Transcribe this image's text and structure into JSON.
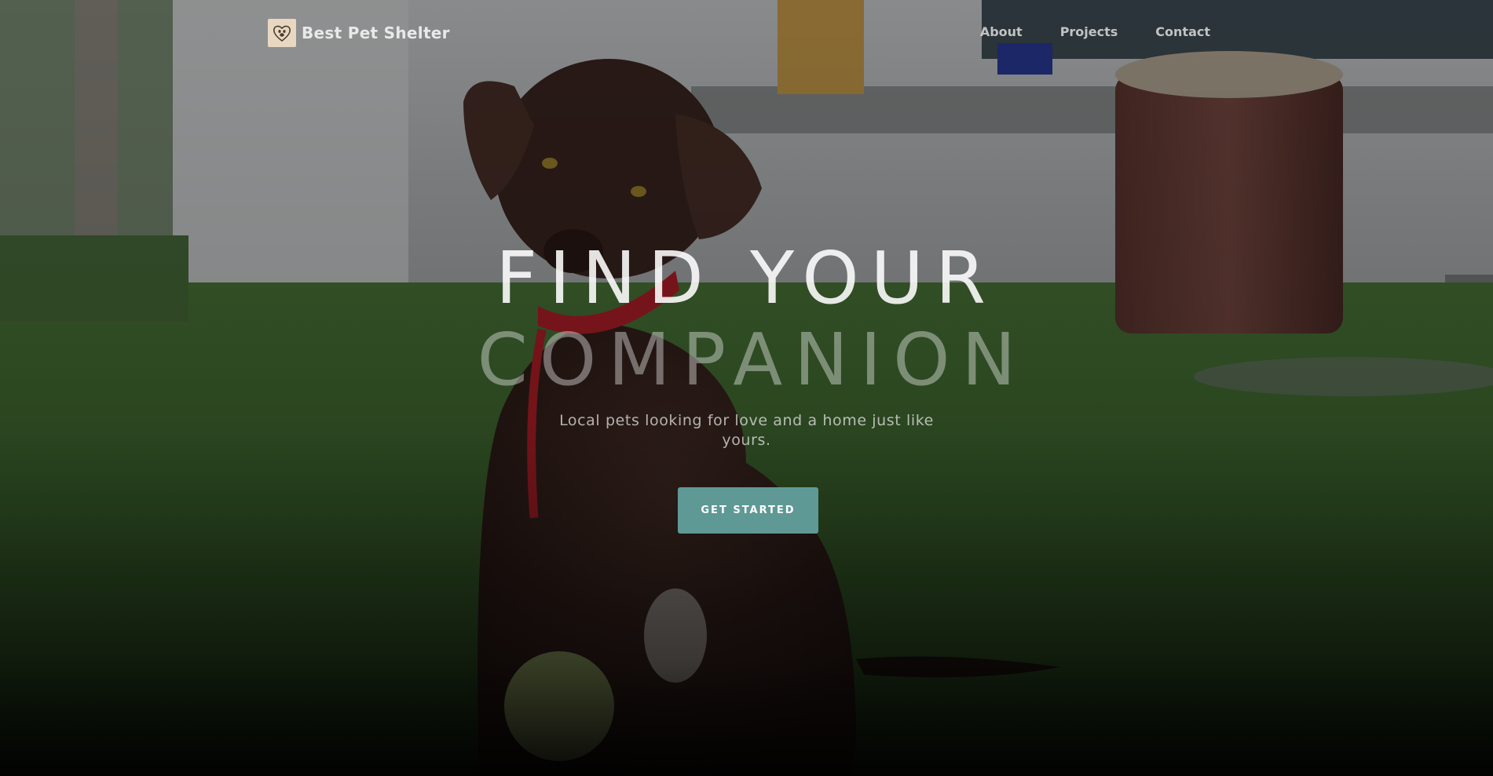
{
  "brand": {
    "name": "Best Pet Shelter",
    "logo_icon": "paw-heart-icon"
  },
  "nav": {
    "items": [
      {
        "label": "About"
      },
      {
        "label": "Projects"
      },
      {
        "label": "Contact"
      }
    ]
  },
  "hero": {
    "headline_line1": "FIND YOUR",
    "headline_line2": "COMPANION",
    "subtitle": "Local pets looking for love and a home just like yours.",
    "cta_label": "GET STARTED",
    "image_subject": "chocolate labrador puppy on grass"
  },
  "colors": {
    "accent": "#5f9996",
    "logo_background": "#e8d8c2",
    "nav_text": "#dcdcdc"
  }
}
